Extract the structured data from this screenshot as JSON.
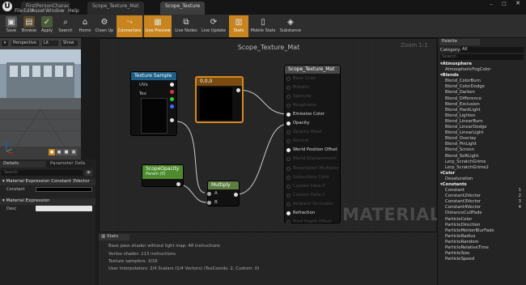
{
  "tabs": [
    "FirstPersonCharacter*",
    "Scope_Texture_Mat",
    "Scope_Texture"
  ],
  "menu": [
    "File",
    "Edit",
    "Asset",
    "Window",
    "Help"
  ],
  "toolbar": {
    "buttons": [
      {
        "label": "Save",
        "icon": "save-icon",
        "active": false
      },
      {
        "label": "Browse",
        "icon": "browse-icon",
        "active": false
      },
      {
        "label": "Apply",
        "icon": "apply-icon",
        "active": false
      },
      {
        "label": "Search",
        "icon": "search-icon",
        "active": false
      },
      {
        "label": "Home",
        "icon": "home-icon",
        "active": false
      },
      {
        "label": "Clean Up",
        "icon": "cleanup-icon",
        "active": false
      },
      {
        "label": "Connectors",
        "icon": "connectors-icon",
        "active": true
      },
      {
        "label": "Live Preview",
        "icon": "live-preview-icon",
        "active": true
      },
      {
        "label": "Live Nodes",
        "icon": "live-nodes-icon",
        "active": false
      },
      {
        "label": "Live Update",
        "icon": "live-update-icon",
        "active": false
      },
      {
        "label": "Stats",
        "icon": "stats-icon",
        "active": true
      },
      {
        "label": "Mobile Stats",
        "icon": "mobile-stats-icon",
        "active": false
      },
      {
        "label": "Substance",
        "icon": "substance-icon",
        "active": false
      }
    ]
  },
  "viewport": {
    "perspective": "Perspective",
    "lit": "Lit",
    "show": "Show"
  },
  "details": {
    "tab1": "Details",
    "tab2": "Parameter Defa",
    "search_placeholder": "Search",
    "section1": "Material Expression Constant 3Vector",
    "constant_label": "Constant",
    "section2": "Material Expression",
    "desc_label": "Desc"
  },
  "graph": {
    "title": "Scope_Texture_Mat",
    "zoom": "Zoom 1:1",
    "watermark": "MATERIAL"
  },
  "nodes": {
    "texture_sample": {
      "title": "Texture Sample",
      "pins": [
        "UVs",
        "Tex"
      ]
    },
    "constant3": {
      "title": "0,0,0"
    },
    "scope_opacity": {
      "title": "ScopeOpacity",
      "subtitle": "Param (0)"
    },
    "multiply": {
      "title": "Multiply",
      "pins": [
        "A",
        "B"
      ]
    },
    "material": {
      "title": "Scope_Texture_Mat",
      "inputs": [
        {
          "label": "Base Color",
          "active": false
        },
        {
          "label": "Metallic",
          "active": false
        },
        {
          "label": "Specular",
          "active": false
        },
        {
          "label": "Roughness",
          "active": false
        },
        {
          "label": "Emissive Color",
          "active": true
        },
        {
          "label": "Opacity",
          "active": true
        },
        {
          "label": "Opacity Mask",
          "active": false
        },
        {
          "label": "Normal",
          "active": false
        },
        {
          "label": "World Position Offset",
          "active": true
        },
        {
          "label": "World Displacement",
          "active": false
        },
        {
          "label": "Tessellation Multiplier",
          "active": false
        },
        {
          "label": "Subsurface Color",
          "active": false
        },
        {
          "label": "Custom Data 0",
          "active": false
        },
        {
          "label": "Custom Data 1",
          "active": false
        },
        {
          "label": "Ambient Occlusion",
          "active": false
        },
        {
          "label": "Refraction",
          "active": true
        },
        {
          "label": "Pixel Depth Offset",
          "active": false
        }
      ]
    }
  },
  "stats": {
    "title": "Stats",
    "lines": [
      "Base pass shader without light map: 48 instructions",
      "Vertex shader: 113 instructions",
      "Texture samplers: 3/16",
      "User interpolators: 2/4 Scalars (1/4 Vectors) (TexCoords: 2, Custom: 0)"
    ]
  },
  "palette": {
    "title": "Palette",
    "category_label": "Category:",
    "category_value": "All",
    "search_placeholder": "Search",
    "items": [
      {
        "t": "Atmosphere",
        "cat": true
      },
      {
        "t": "AtmosphericFogColor"
      },
      {
        "t": "Blends",
        "cat": true
      },
      {
        "t": "Blend_ColorBurn"
      },
      {
        "t": "Blend_ColorDodge"
      },
      {
        "t": "Blend_Darken"
      },
      {
        "t": "Blend_Difference"
      },
      {
        "t": "Blend_Exclusion"
      },
      {
        "t": "Blend_HardLight"
      },
      {
        "t": "Blend_Lighten"
      },
      {
        "t": "Blend_LinearBurn"
      },
      {
        "t": "Blend_LinearDodge"
      },
      {
        "t": "Blend_LinearLight"
      },
      {
        "t": "Blend_Overlay"
      },
      {
        "t": "Blend_PinLight"
      },
      {
        "t": "Blend_Screen"
      },
      {
        "t": "Blend_SoftLight"
      },
      {
        "t": "Lerp_ScratchGrime"
      },
      {
        "t": "Lerp_ScratchGrime2"
      },
      {
        "t": "Color",
        "cat": true
      },
      {
        "t": "Desaturation"
      },
      {
        "t": "Constants",
        "cat": true
      },
      {
        "t": "Constant",
        "k": "1"
      },
      {
        "t": "Constant2Vector",
        "k": "2"
      },
      {
        "t": "Constant3Vector",
        "k": "3"
      },
      {
        "t": "Constant4Vector",
        "k": "4"
      },
      {
        "t": "DistanceCullFade"
      },
      {
        "t": "ParticleColor"
      },
      {
        "t": "ParticleDirection"
      },
      {
        "t": "ParticleMotionBlurFade"
      },
      {
        "t": "ParticleRadius"
      },
      {
        "t": "ParticleRandom"
      },
      {
        "t": "ParticleRelativeTime"
      },
      {
        "t": "ParticleSize"
      },
      {
        "t": "ParticleSpeed"
      }
    ]
  },
  "colors": {
    "accent": "#c8841e",
    "texture_header": "#1f5f86",
    "scope_header": "#4f8a2c",
    "multiply_header": "#5e7d41",
    "material_header": "#474747",
    "constant_border": "#d98a1c"
  }
}
